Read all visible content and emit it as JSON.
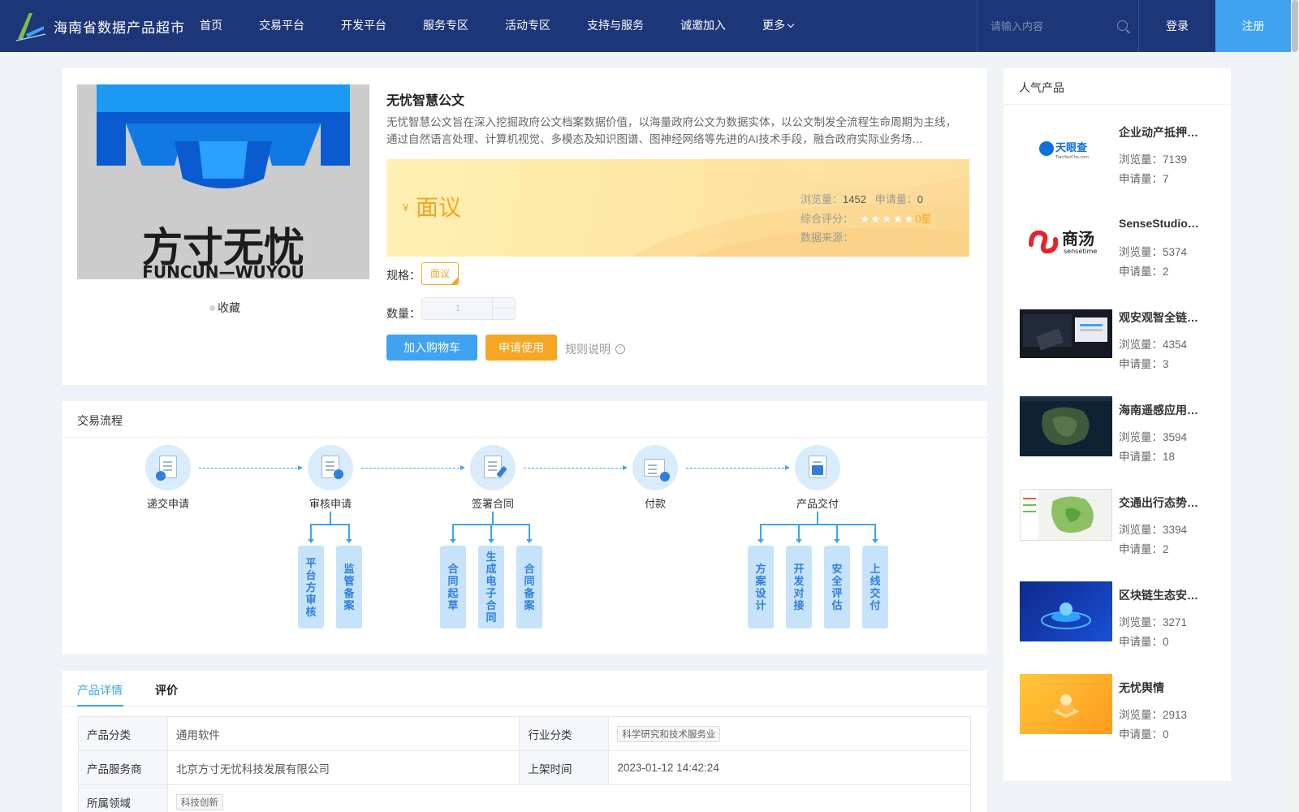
{
  "header": {
    "brand": "海南省数据产品超市",
    "nav": [
      "首页",
      "交易平台",
      "开发平台",
      "服务专区",
      "活动专区",
      "支持与服务",
      "诚邀加入",
      "更多"
    ],
    "search_placeholder": "请输入内容",
    "login": "登录",
    "register": "注册",
    "colors": {
      "bar": "#1d3678",
      "register_bg": "#3fa3f2"
    }
  },
  "product": {
    "image_logo_text": "方寸无忧",
    "image_logo_sub": "FUNCUN—WUYOU",
    "favorite": "收藏",
    "title": "无忧智慧公文",
    "description": "无忧智慧公文旨在深入挖掘政府公文档案数据价值，以海量政府公文为数据实体，以公文制发全流程生命周期为主线，通过自然语言处理、计算机视觉、多模态及知识图谱、图神经网络等先进的AI技术手段，融合政府实际业务场…",
    "price_symbol": "¥",
    "price": "面议",
    "views_label": "浏览量：",
    "views": "1452",
    "applies_label": "申请量：",
    "applies": "0",
    "rating_label": "综合评分：",
    "rating_stars": "★★★★★",
    "rating": 0,
    "rating_text": "0星",
    "source_label": "数据来源：",
    "spec_label": "规格：",
    "spec": "面议",
    "qty_label": "数量：",
    "qty": "1",
    "add_to_cart": "加入购物车",
    "apply": "申请使用",
    "rules": "规则说明",
    "info_glyph": "!",
    "colors": {
      "accent": "#f5a623",
      "primary": "#3fa3f2"
    }
  },
  "process": {
    "title": "交易流程",
    "steps": [
      {
        "label": "递交申请",
        "icon": "application-icon"
      },
      {
        "label": "审核申请",
        "icon": "review-icon"
      },
      {
        "label": "签署合同",
        "icon": "contract-icon"
      },
      {
        "label": "付款",
        "icon": "payment-icon"
      },
      {
        "label": "产品交付",
        "icon": "delivery-icon"
      }
    ],
    "sub_steps": {
      "review": [
        "平台方审核",
        "监管备案"
      ],
      "contract": [
        "合同起草",
        "生成电子合同",
        "合同备案"
      ],
      "delivery": [
        "方案设计",
        "开发对接",
        "安全评估",
        "上线交付"
      ]
    }
  },
  "details": {
    "tabs": [
      "产品详情",
      "评价"
    ],
    "rows": [
      {
        "k1": "产品分类",
        "v1": "通用软件",
        "k2": "行业分类",
        "v2": "科学研究和技术服务业"
      },
      {
        "k1": "产品服务商",
        "v1": "北京方寸无忧科技发展有限公司",
        "k2": "上架时间",
        "v2": "2023-01-12 14:42:24"
      },
      {
        "k1": "所属领域",
        "v1": "科技创新"
      }
    ]
  },
  "sidebar": {
    "title": "人气产品",
    "views_label": "浏览量：",
    "applies_label": "申请量：",
    "items": [
      {
        "name": "企业动产抵押…",
        "views": "7139",
        "applies": "7",
        "logo_text": "天眼查",
        "logo_sub": "TianYanCha.com"
      },
      {
        "name": "SenseStudio…",
        "views": "5374",
        "applies": "2",
        "logo_text": "商汤",
        "logo_sub": "sensetime"
      },
      {
        "name": "观安观智全链…",
        "views": "4354",
        "applies": "3"
      },
      {
        "name": "海南遥感应用…",
        "views": "3594",
        "applies": "18"
      },
      {
        "name": "交通出行态势…",
        "views": "3394",
        "applies": "2"
      },
      {
        "name": "区块链生态安…",
        "views": "3271",
        "applies": "0"
      },
      {
        "name": "无忧舆情",
        "views": "2913",
        "applies": "0"
      }
    ]
  }
}
